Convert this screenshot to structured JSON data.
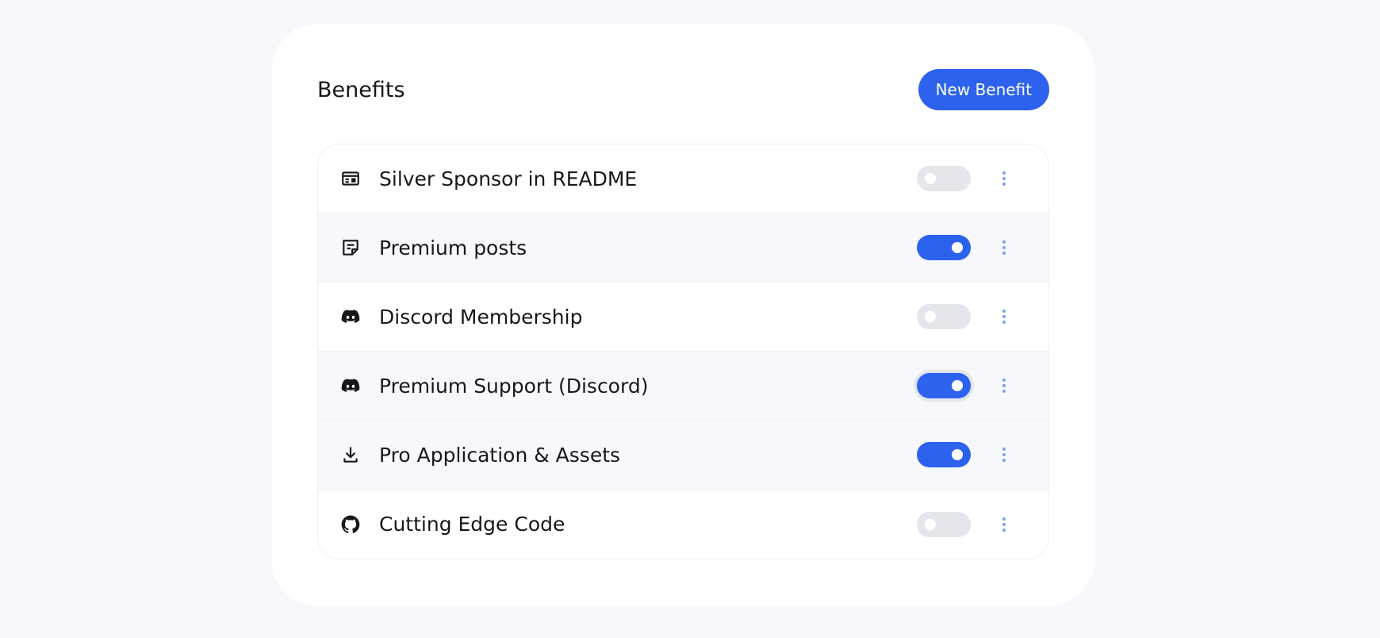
{
  "header": {
    "title": "Benefits",
    "new_button_label": "New Benefit"
  },
  "colors": {
    "accent": "#2d62ef",
    "toggle_off": "#e4e6ec",
    "menu_dots": "#7e9ff0"
  },
  "benefits": [
    {
      "label": "Silver Sponsor in README",
      "icon": "ad-banner-icon",
      "enabled": false
    },
    {
      "label": "Premium posts",
      "icon": "article-icon",
      "enabled": true
    },
    {
      "label": "Discord Membership",
      "icon": "discord-icon",
      "enabled": false
    },
    {
      "label": "Premium Support (Discord)",
      "icon": "discord-icon",
      "enabled": true
    },
    {
      "label": "Pro Application & Assets",
      "icon": "download-icon",
      "enabled": true
    },
    {
      "label": "Cutting Edge Code",
      "icon": "github-icon",
      "enabled": false
    }
  ]
}
